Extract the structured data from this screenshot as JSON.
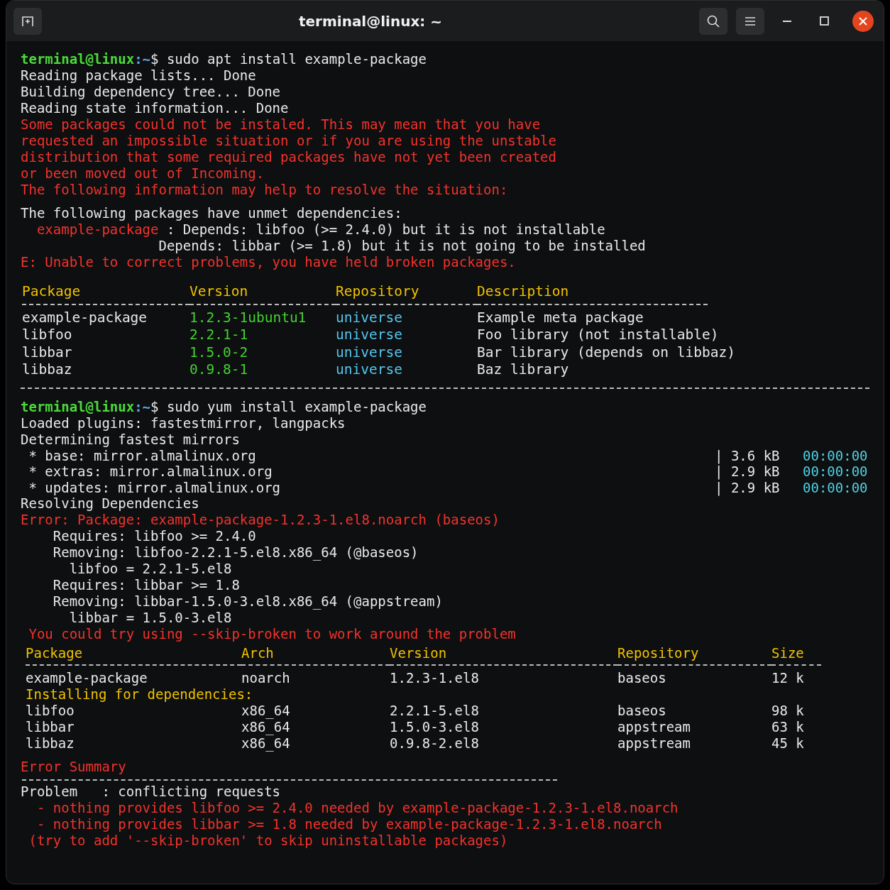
{
  "window": {
    "title": "terminal@linux: ~"
  },
  "blocks": [
    {
      "kind": "prompt",
      "user": "terminal@linux",
      "path": ":~",
      "command": "$ sudo apt install example-package"
    },
    {
      "kind": "line",
      "parts": [
        {
          "kind": "plain",
          "text": "Reading package lists... Done"
        }
      ]
    },
    {
      "kind": "line",
      "parts": [
        {
          "kind": "plain",
          "text": "Building dependency tree... Done"
        }
      ]
    },
    {
      "kind": "line",
      "parts": [
        {
          "kind": "plain",
          "text": "Reading state information... Done"
        }
      ]
    },
    {
      "kind": "line",
      "parts": [
        {
          "kind": "error",
          "text": "Some packages could not be instaled. This may mean that you have"
        }
      ]
    },
    {
      "kind": "line",
      "parts": [
        {
          "kind": "error",
          "text": "requested an impossible situation or if you are using the unstable"
        }
      ]
    },
    {
      "kind": "line",
      "parts": [
        {
          "kind": "error",
          "text": "distribution that some required packages have not yet been created"
        }
      ]
    },
    {
      "kind": "line",
      "parts": [
        {
          "kind": "error",
          "text": "or been moved out of Incoming."
        }
      ]
    },
    {
      "kind": "line",
      "parts": [
        {
          "kind": "error",
          "text": "The following information may help to resolve the situation:"
        }
      ]
    },
    {
      "kind": "spaced_line",
      "parts": [
        {
          "kind": "plain",
          "text": "The following packages have unmet dependencies:"
        }
      ]
    },
    {
      "kind": "line",
      "parts": [
        {
          "kind": "error",
          "text": "  example-package"
        },
        {
          "kind": "plain",
          "text": " : Depends: libfoo (>= 2.4.0) but it is not installable"
        }
      ]
    },
    {
      "kind": "line",
      "parts": [
        {
          "kind": "plain",
          "text": "                 Depends: libbar (>= 1.8) but it is not going to be installed"
        }
      ]
    },
    {
      "kind": "line",
      "parts": [
        {
          "kind": "error",
          "text": "E: Unable to correct problems, you have held broken packages."
        }
      ]
    },
    {
      "kind": "apt_table",
      "columns": [
        {
          "label": "Package",
          "kind": "plain"
        },
        {
          "label": "Version",
          "kind": "version"
        },
        {
          "label": "Repository",
          "kind": "repo"
        },
        {
          "label": "Description",
          "kind": "plain"
        }
      ],
      "rows": [
        {
          "kind": "row",
          "cells": [
            "example-package",
            "1.2.3-1ubuntu1",
            "universe",
            "Example meta package"
          ]
        },
        {
          "kind": "row",
          "cells": [
            "libfoo",
            "2.2.1-1",
            "universe",
            "Foo library (not installable)"
          ]
        },
        {
          "kind": "row",
          "cells": [
            "libbar",
            "1.5.0-2",
            "universe",
            "Bar library (depends on libbaz)"
          ]
        },
        {
          "kind": "row",
          "cells": [
            "libbaz",
            "0.9.8-1",
            "universe",
            "Baz library"
          ]
        }
      ]
    },
    {
      "kind": "rule"
    },
    {
      "kind": "prompt",
      "user": "terminal@linux",
      "path": ":~",
      "command": "$ sudo yum install example-package"
    },
    {
      "kind": "line",
      "parts": [
        {
          "kind": "plain",
          "text": "Loaded plugins: fastestmirror, langpacks"
        }
      ]
    },
    {
      "kind": "line",
      "parts": [
        {
          "kind": "plain",
          "text": "Determining fastest mirrors"
        }
      ]
    },
    {
      "kind": "mirror",
      "name": " * base: mirror.almalinux.org",
      "size": "| 3.6 kB",
      "time": "00:00:00"
    },
    {
      "kind": "mirror",
      "name": " * extras: mirror.almalinux.org",
      "size": "| 2.9 kB",
      "time": "00:00:00"
    },
    {
      "kind": "mirror",
      "name": " * updates: mirror.almalinux.org",
      "size": "| 2.9 kB",
      "time": "00:00:00"
    },
    {
      "kind": "line",
      "parts": [
        {
          "kind": "plain",
          "text": "Resolving Dependencies"
        }
      ]
    },
    {
      "kind": "line",
      "parts": [
        {
          "kind": "error",
          "text": "Error: Package: example-package-1.2.3-1.el8.noarch (baseos)"
        }
      ]
    },
    {
      "kind": "line",
      "parts": [
        {
          "kind": "plain",
          "text": "    Requires: libfoo >= 2.4.0"
        }
      ]
    },
    {
      "kind": "line",
      "parts": [
        {
          "kind": "plain",
          "text": "    Removing: libfoo-2.2.1-5.el8.x86_64 (@baseos)"
        }
      ]
    },
    {
      "kind": "line",
      "parts": [
        {
          "kind": "plain",
          "text": "      libfoo = 2.2.1-5.el8"
        }
      ]
    },
    {
      "kind": "line",
      "parts": [
        {
          "kind": "plain",
          "text": "    Requires: libbar >= 1.8"
        }
      ]
    },
    {
      "kind": "line",
      "parts": [
        {
          "kind": "plain",
          "text": "    Removing: libbar-1.5.0-3.el8.x86_64 (@appstream)"
        }
      ]
    },
    {
      "kind": "line",
      "parts": [
        {
          "kind": "plain",
          "text": "      libbar = 1.5.0-3.el8"
        }
      ]
    },
    {
      "kind": "line",
      "parts": [
        {
          "kind": "error",
          "text": " You could try using --skip-broken to work around the problem"
        }
      ]
    },
    {
      "kind": "yum_table",
      "columns": [
        {
          "label": "Package",
          "kind": "plain"
        },
        {
          "label": "Arch",
          "kind": "plain"
        },
        {
          "label": "Version",
          "kind": "plain"
        },
        {
          "label": "Repository",
          "kind": "plain"
        },
        {
          "label": "Size",
          "kind": "plain"
        }
      ],
      "rows": [
        {
          "kind": "row",
          "cells": [
            "example-package",
            "noarch",
            "1.2.3-1.el8",
            "baseos",
            "12 k"
          ]
        },
        {
          "kind": "section",
          "text": "Installing for dependencies:"
        },
        {
          "kind": "row",
          "cells": [
            "libfoo",
            "x86_64",
            "2.2.1-5.el8",
            "baseos",
            "98 k"
          ]
        },
        {
          "kind": "row",
          "cells": [
            "libbar",
            "x86_64",
            "1.5.0-3.el8",
            "appstream",
            "63 k"
          ]
        },
        {
          "kind": "row",
          "cells": [
            "libbaz",
            "x86_64",
            "0.9.8-2.el8",
            "appstream",
            "45 k"
          ]
        }
      ]
    },
    {
      "kind": "summary_heading",
      "text": "Error Summary"
    },
    {
      "kind": "line",
      "parts": [
        {
          "kind": "plain",
          "text": "Problem   : conflicting requests"
        }
      ]
    },
    {
      "kind": "line",
      "parts": [
        {
          "kind": "error",
          "text": "  - nothing provides libfoo >= 2.4.0 needed by example-package-1.2.3-1.el8.noarch"
        }
      ]
    },
    {
      "kind": "line",
      "parts": [
        {
          "kind": "error",
          "text": "  - nothing provides libbar >= 1.8 needed by example-package-1.2.3-1.el8.noarch"
        }
      ]
    },
    {
      "kind": "line",
      "parts": [
        {
          "kind": "error",
          "text": " (try to add '--skip-broken' to skip uninstallable packages)"
        }
      ]
    }
  ]
}
